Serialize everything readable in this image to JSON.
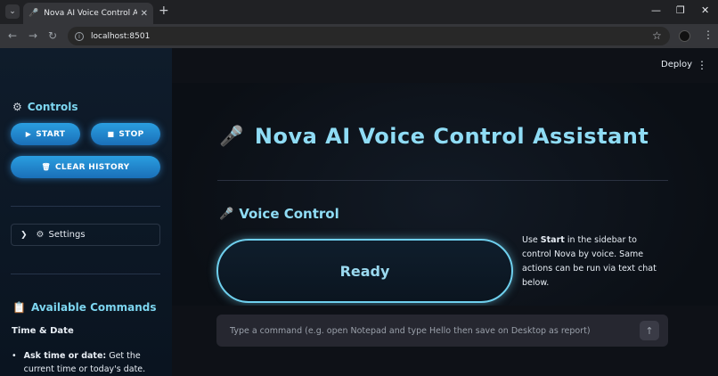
{
  "browser": {
    "tab_title": "Nova AI Voice Control Assistant",
    "url": "localhost:8501"
  },
  "header": {
    "deploy_label": "Deploy"
  },
  "sidebar": {
    "controls_heading": "Controls",
    "start_label": "START",
    "stop_label": "STOP",
    "clear_history_label": "CLEAR HISTORY",
    "settings_label": "Settings",
    "commands_heading": "Available Commands",
    "category_time": "Time & Date",
    "command_item_title": "Ask time or date:",
    "command_item_desc": " Get the current time or today's date."
  },
  "main": {
    "title": "Nova AI Voice Control Assistant",
    "section_title": "Voice Control",
    "status": "Ready",
    "help_pre": "Use ",
    "help_bold": "Start",
    "help_post": " in the sidebar to control Nova by voice. Same actions can be run via text chat below."
  },
  "chat": {
    "placeholder": "Type a command (e.g. open Notepad and type Hello then save on Desktop as report)",
    "value": ""
  },
  "icons": {
    "controls": "gear-icon",
    "start": "play-icon",
    "stop": "stop-icon",
    "clear": "trash-icon",
    "settings": "gear-icon",
    "commands": "clipboard-icon",
    "title": "microphone-icon",
    "send": "arrow-up-icon"
  },
  "colors": {
    "accent_cyan": "#8fdcf5",
    "button_blue": "#2a9ee0",
    "sidebar_bg": "#0f1c2b",
    "main_bg": "#0b0f14"
  }
}
